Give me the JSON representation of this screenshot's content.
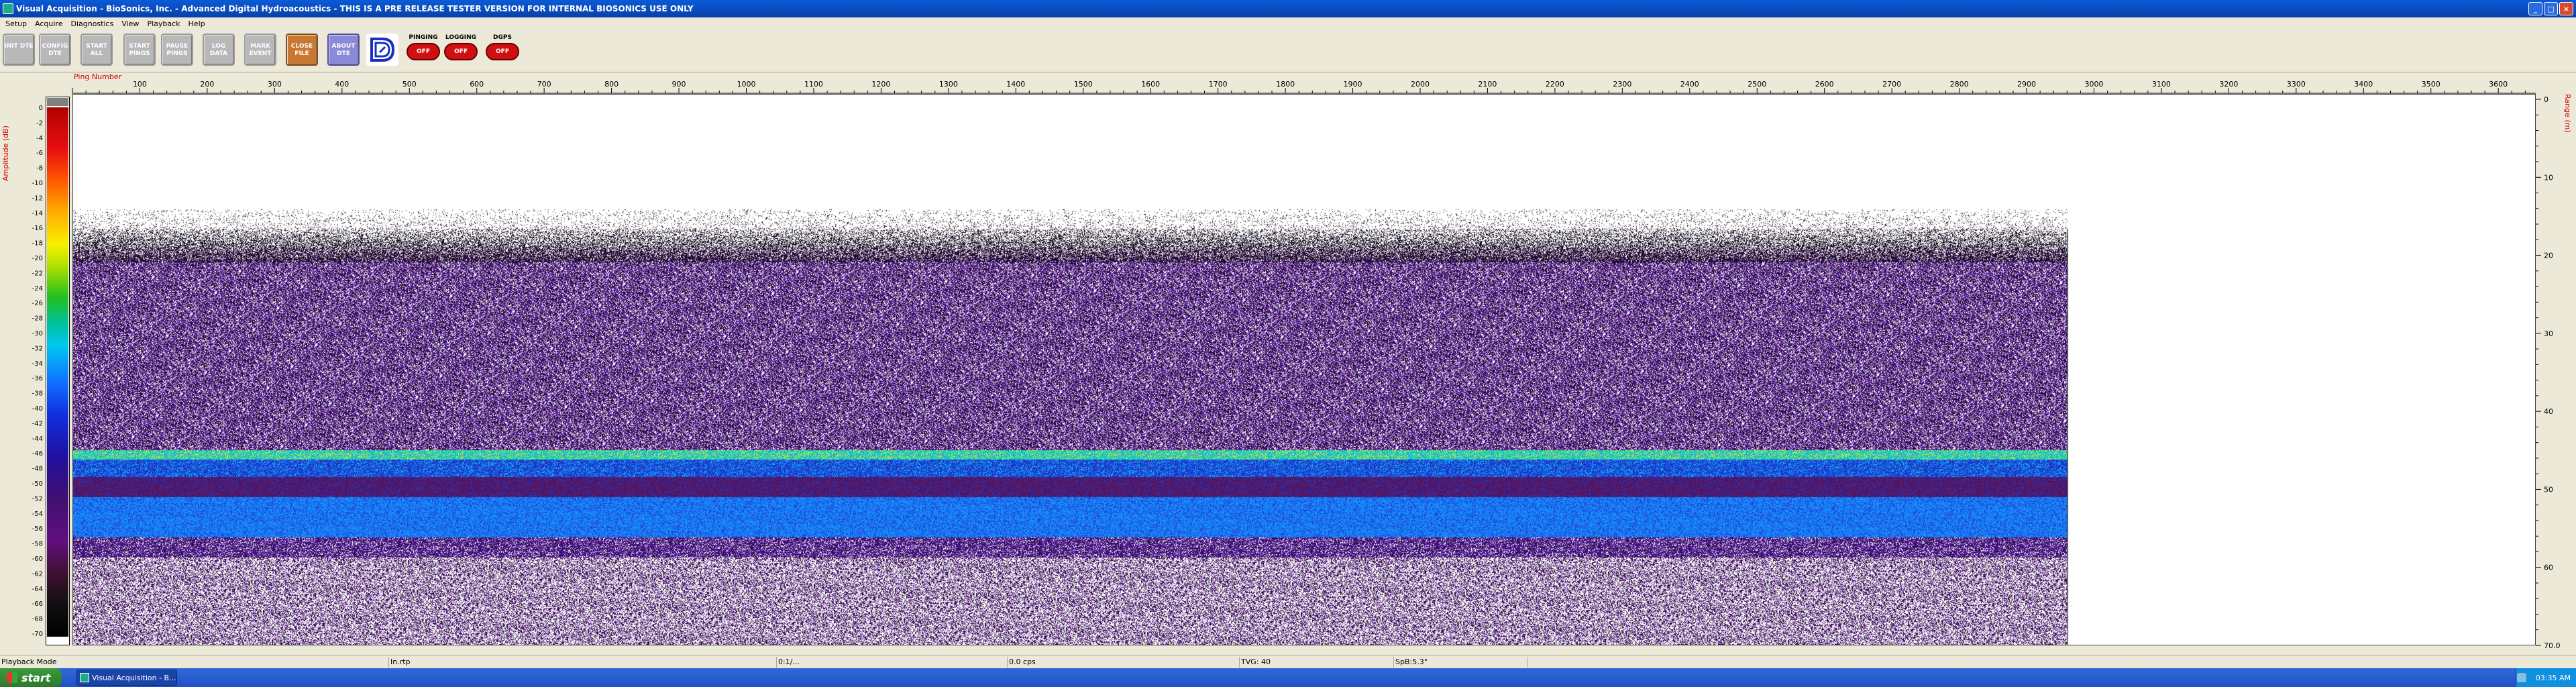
{
  "window": {
    "title": "Visual Acquisition  -  BioSonics, Inc.  -  Advanced Digital Hydroacoustics  -  THIS IS A PRE RELEASE TESTER VERSION FOR INTERNAL BIOSONICS USE ONLY"
  },
  "menu": [
    "Setup",
    "Acquire",
    "Diagnostics",
    "View",
    "Playback",
    "Help"
  ],
  "toolbar": {
    "buttons": [
      {
        "id": "init-dte",
        "label": "INIT DTE",
        "style": "gray"
      },
      {
        "id": "config-dte",
        "label": "CONFIG DTE",
        "style": "gray"
      },
      {
        "id": "start-all",
        "label": "START ALL",
        "style": "gray"
      },
      {
        "id": "start-pings",
        "label": "START PINGS",
        "style": "gray"
      },
      {
        "id": "pause-pings",
        "label": "PAUSE PINGS",
        "style": "gray"
      },
      {
        "id": "log-data",
        "label": "LOG DATA",
        "style": "gray"
      },
      {
        "id": "mark-event",
        "label": "MARK EVENT",
        "style": "gray"
      },
      {
        "id": "close-file",
        "label": "CLOSE FILE",
        "style": "orange"
      },
      {
        "id": "about-dte",
        "label": "ABOUT DTE",
        "style": "blue"
      }
    ],
    "status": [
      {
        "label": "PINGING",
        "state": "OFF"
      },
      {
        "label": "LOGGING",
        "state": "OFF"
      },
      {
        "label": "DGPS",
        "state": "OFF"
      }
    ]
  },
  "echogram": {
    "x_axis_title": "Ping Number",
    "x_ticks": [
      "100",
      "200",
      "300",
      "400",
      "500",
      "600",
      "700",
      "800",
      "900",
      "1000",
      "1100",
      "1200",
      "1300",
      "1400",
      "1500",
      "1600",
      "1700",
      "1800",
      "1900",
      "2000",
      "2100",
      "2200",
      "2300",
      "2400",
      "2500",
      "2600",
      "2700",
      "2800",
      "2900",
      "3000",
      "3100",
      "3200",
      "3300",
      "3400",
      "3500",
      "3600"
    ],
    "left_axis_title": "Amplitude (dB)",
    "amplitude_ticks": [
      "0",
      "-2",
      "-4",
      "-6",
      "-8",
      "-10",
      "-12",
      "-14",
      "-16",
      "-18",
      "-20",
      "-22",
      "-24",
      "-26",
      "-28",
      "-30",
      "-32",
      "-34",
      "-36",
      "-38",
      "-40",
      "-42",
      "-44",
      "-46",
      "-48",
      "-50",
      "-52",
      "-54",
      "-56",
      "-58",
      "-60",
      "-62",
      "-64",
      "-66",
      "-68",
      "-70"
    ],
    "right_axis_title": "Range (m)",
    "range_ticks": [
      "0",
      "10",
      "20",
      "30",
      "40",
      "50",
      "60",
      "70.0"
    ],
    "data_end_ping": 2960,
    "band_colors": {
      "bottom_primary": "#20d8a0",
      "bottom_secondary": "#1a8cff",
      "noise": "#4a1a8a"
    }
  },
  "statusbar": {
    "cells": [
      "Playback Mode",
      "In.rtp",
      "0:1/...",
      "0.0 cps",
      "TVG: 40",
      "SpB:5.3°"
    ]
  },
  "taskbar": {
    "start_label": "start",
    "task_label": "Visual Acquisition - B...",
    "clock": "03:35 AM"
  }
}
